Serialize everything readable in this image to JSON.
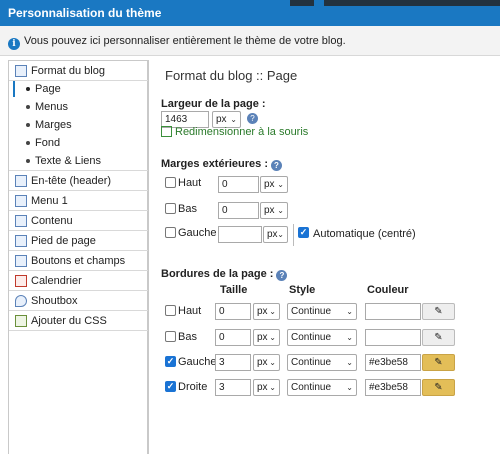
{
  "window": {
    "title": "Personnalisation du thème"
  },
  "info": {
    "text": "Vous pouvez ici personnaliser entièrement le thème de votre blog."
  },
  "sidebar": {
    "items": [
      {
        "label": "Format du blog",
        "icon": "format-icon"
      },
      {
        "label": "Page",
        "sub": true
      },
      {
        "label": "Menus",
        "sub": true
      },
      {
        "label": "Marges",
        "sub": true
      },
      {
        "label": "Fond",
        "sub": true
      },
      {
        "label": "Texte & Liens",
        "sub": true
      },
      {
        "label": "En-tête (header)",
        "icon": "header-icon"
      },
      {
        "label": "Menu 1",
        "icon": "menu-icon"
      },
      {
        "label": "Contenu",
        "icon": "content-icon"
      },
      {
        "label": "Pied de page",
        "icon": "footer-icon"
      },
      {
        "label": "Boutons et champs",
        "icon": "buttons-icon"
      },
      {
        "label": "Calendrier",
        "icon": "calendar-icon"
      },
      {
        "label": "Shoutbox",
        "icon": "shoutbox-icon"
      },
      {
        "label": "Ajouter du CSS",
        "icon": "css-icon"
      }
    ]
  },
  "main": {
    "title": "Format du blog :: Page",
    "width_section": {
      "label": "Largeur de la page :",
      "value": "1463",
      "unit": "px",
      "resize_link": "Redimensionner à la souris"
    },
    "margins_section": {
      "label": "Marges extérieures :",
      "rows": [
        {
          "label": "Haut",
          "value": "0",
          "unit": "px",
          "checked": false
        },
        {
          "label": "Bas",
          "value": "0",
          "unit": "px",
          "checked": false
        },
        {
          "label": "Gauche",
          "value": "",
          "unit": "px",
          "checked": false
        }
      ],
      "auto_label": "Automatique (centré)",
      "auto_checked": true
    },
    "borders_section": {
      "label": "Bordures de la page :",
      "col_taille": "Taille",
      "col_style": "Style",
      "col_couleur": "Couleur",
      "rows": [
        {
          "label": "Haut",
          "checked": false,
          "size": "0",
          "unit": "px",
          "style": "Continue",
          "color": "",
          "picker_color": "#eeeeee"
        },
        {
          "label": "Bas",
          "checked": false,
          "size": "0",
          "unit": "px",
          "style": "Continue",
          "color": "",
          "picker_color": "#eeeeee"
        },
        {
          "label": "Gauche",
          "checked": true,
          "size": "3",
          "unit": "px",
          "style": "Continue",
          "color": "#e3be58",
          "picker_color": "#e3be58"
        },
        {
          "label": "Droite",
          "checked": true,
          "size": "3",
          "unit": "px",
          "style": "Continue",
          "color": "#e3be58",
          "picker_color": "#e3be58"
        }
      ]
    }
  }
}
